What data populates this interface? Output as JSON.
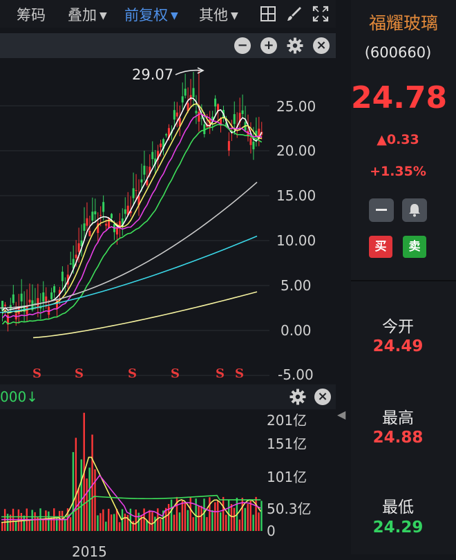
{
  "toolbar": {
    "chip_label": "筹码",
    "overlay_label": "叠加",
    "adjust_label": "前复权",
    "other_label": "其他"
  },
  "chart": {
    "peak_label": "29.07",
    "y_ticks": [
      "25.00",
      "20.00",
      "15.00",
      "10.00",
      "5.00",
      "0.00",
      "-5.00"
    ],
    "signal_marks": [
      "S",
      "S",
      "S",
      "S",
      "S",
      "S"
    ],
    "colors": {
      "up": "#ff3838",
      "down": "#33d160",
      "ma5": "#ffffff",
      "ma10": "#f5f06a",
      "ma20": "#e840e8",
      "ma30": "#3ee05a",
      "ma60": "#c9c9c9",
      "ma120": "#3ad6e6",
      "ma250": "#f5f2a0"
    }
  },
  "volume": {
    "title_fragment": "000↓",
    "y_ticks": [
      "201亿",
      "151亿",
      "101亿",
      "50.3亿",
      "0"
    ],
    "x_label": "2015"
  },
  "stock": {
    "name": "福耀玻璃",
    "code": "(600660)",
    "price": "24.78",
    "change": "0.33",
    "change_pct": "+1.35%",
    "buy_label": "买",
    "sell_label": "卖",
    "open_label": "今开",
    "open_value": "24.49",
    "high_label": "最高",
    "high_value": "24.88",
    "low_label": "最低",
    "low_value": "24.29"
  }
}
